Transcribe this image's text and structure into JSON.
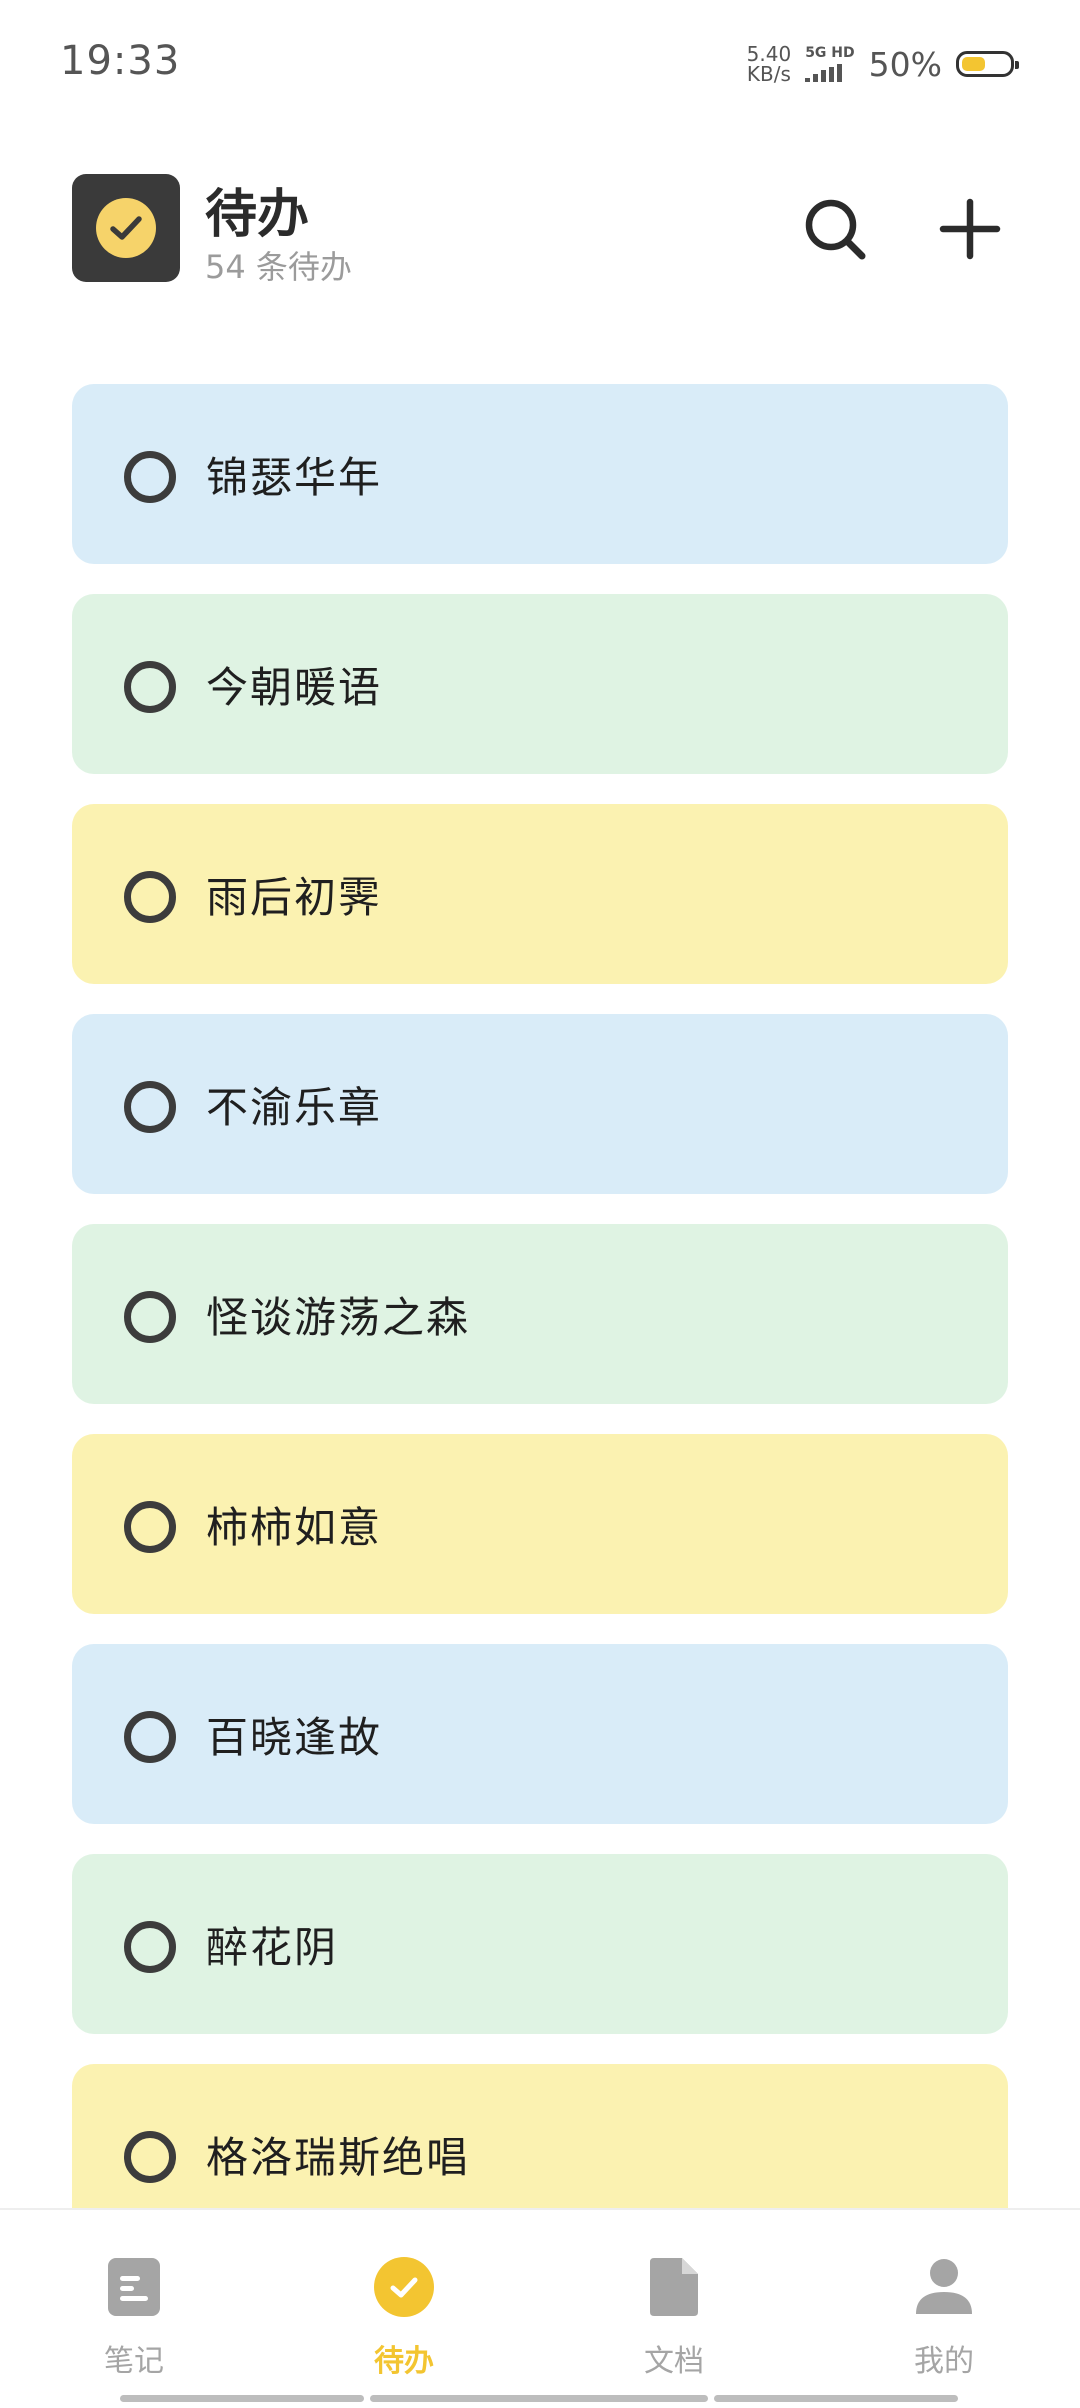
{
  "status": {
    "time": "19:33",
    "net_speed_value": "5.40",
    "net_speed_unit": "KB/s",
    "network_label": "5G HD",
    "battery_pct": "50%",
    "battery_level": 0.5
  },
  "header": {
    "title": "待办",
    "subtitle": "54 条待办",
    "logo_icon": "checkmark-circle-icon",
    "search_icon": "search-icon",
    "add_icon": "plus-icon"
  },
  "todos": [
    {
      "text": "锦瑟华年",
      "color": "#d9ecf8"
    },
    {
      "text": "今朝暖语",
      "color": "#dff3e3"
    },
    {
      "text": "雨后初霁",
      "color": "#fbf2b1"
    },
    {
      "text": "不渝乐章",
      "color": "#d9ecf8"
    },
    {
      "text": "怪谈游荡之森",
      "color": "#dff3e3"
    },
    {
      "text": "柿柿如意",
      "color": "#fbf2b1"
    },
    {
      "text": "百晓逢故",
      "color": "#d9ecf8"
    },
    {
      "text": "醉花阴",
      "color": "#dff3e3"
    },
    {
      "text": "格洛瑞斯绝唱",
      "color": "#fbf2b1"
    }
  ],
  "nav": [
    {
      "label": "笔记",
      "icon": "note-icon",
      "active": false
    },
    {
      "label": "待办",
      "icon": "todo-check-icon",
      "active": true
    },
    {
      "label": "文档",
      "icon": "document-icon",
      "active": false
    },
    {
      "label": "我的",
      "icon": "profile-icon",
      "active": false
    }
  ],
  "colors": {
    "accent": "#f3c531",
    "inactive": "#a5a5a5"
  }
}
